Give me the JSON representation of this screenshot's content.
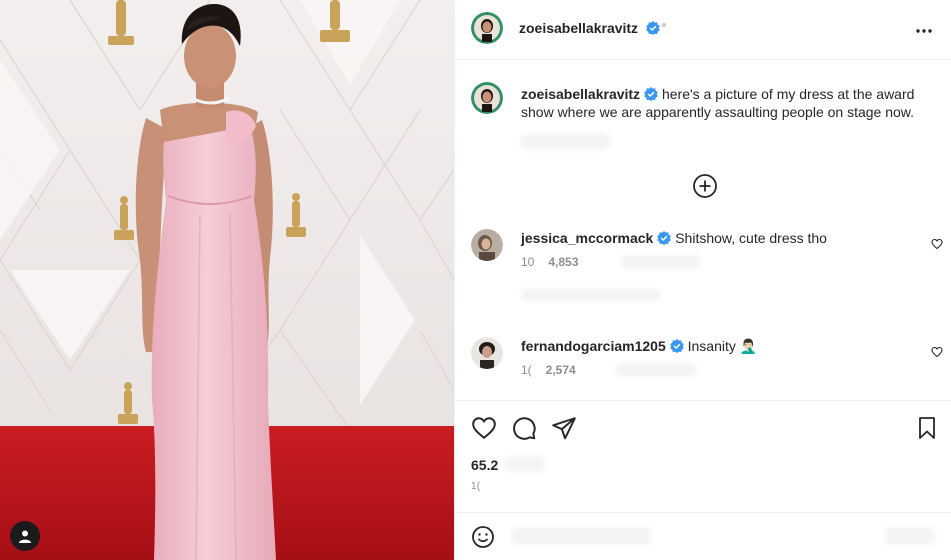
{
  "post": {
    "author": "zoeisabellakravitz",
    "caption": "here's a picture of my dress at the award show where we are apparently assaulting people on stage now.",
    "likes": "65.2",
    "date": "1("
  },
  "header": {
    "username": "zoeisabellakravitz",
    "more_icon": "more-horizontal-icon"
  },
  "comments": [
    {
      "username": "jessica_mccormack",
      "text": "Shitshow, cute dress tho",
      "time": "10",
      "likes": "4,853"
    },
    {
      "username": "fernandogarciam1205",
      "text": "Insanity 🤦🏻‍♂️",
      "time": "1(",
      "likes": "2,574"
    }
  ],
  "colors": {
    "verified": "#3897f0",
    "text": "#262626",
    "muted": "#8e8e8e",
    "dress": "#f3c3cf",
    "carpet": "#c8181e",
    "border": "#efefef"
  },
  "icons": [
    "verified-badge-icon",
    "plus-circle-icon",
    "heart-icon",
    "comment-icon",
    "share-icon",
    "bookmark-icon",
    "emoji-icon",
    "user-icon"
  ]
}
